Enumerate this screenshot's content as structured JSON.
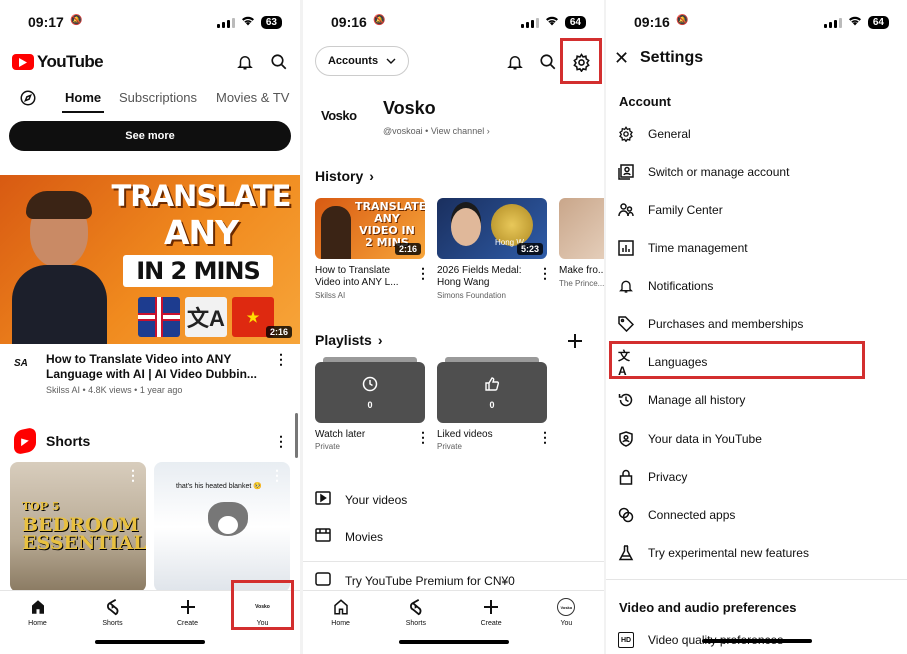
{
  "status": {
    "p1_time": "09:17",
    "p2_time": "09:16",
    "p3_time": "09:16",
    "p1_battery": "63",
    "p2_battery": "64",
    "p3_battery": "64"
  },
  "colors": {
    "youtube_red": "#ff0000",
    "highlight_box": "#d32f2f"
  },
  "home": {
    "logo_text": "YouTube",
    "tabs": [
      "Home",
      "Subscriptions",
      "Movies & TV"
    ],
    "see_more": "See more",
    "featured": {
      "thumb_line1": "TRANSLATE",
      "thumb_line2": "ANY VIDEO",
      "thumb_line3": "IN 2 MINS",
      "duration": "2:16",
      "channel_logo": "SA",
      "title": "How to Translate Video into ANY Language with AI | AI Video Dubbin...",
      "meta": "Skilss AI • 4.8K views • 1 year ago"
    },
    "shorts_label": "Shorts",
    "short1_line1": "TOP 5",
    "short1_line2": "BEDROOM",
    "short1_line3": "ESSENTIALS",
    "short2_caption": "that's his heated blanket 🥺"
  },
  "nav": {
    "home": "Home",
    "shorts": "Shorts",
    "create": "Create",
    "you": "You",
    "you_avatar": "Vosko"
  },
  "you_page": {
    "accounts_label": "Accounts",
    "channel_logo": "Vosko",
    "channel_name": "Vosko",
    "handle": "@voskoai",
    "view_channel": "View channel",
    "history_label": "History",
    "history": [
      {
        "title": "How to Translate Video into ANY L...",
        "channel": "Skilss AI",
        "duration": "2:16",
        "thumb_text": "TRANSLATE ANY VIDEO IN 2 MINS"
      },
      {
        "title": "2026 Fields Medal: Hong Wang",
        "channel": "Simons Foundation",
        "duration": "5:23",
        "thumb_text": "Hong W..."
      },
      {
        "title": "Make fro... ice crean...",
        "channel": "The Prince..."
      }
    ],
    "playlists_label": "Playlists",
    "playlists": [
      {
        "title": "Watch later",
        "sub": "Private",
        "count": "0"
      },
      {
        "title": "Liked videos",
        "sub": "Private",
        "count": "0"
      }
    ],
    "your_videos": "Your videos",
    "movies": "Movies",
    "premium": "Try YouTube Premium for CN¥0"
  },
  "settings": {
    "title": "Settings",
    "account_section": "Account",
    "items": [
      {
        "label": "General",
        "icon": "gear-icon"
      },
      {
        "label": "Switch or manage account",
        "icon": "switch-account-icon"
      },
      {
        "label": "Family Center",
        "icon": "family-icon"
      },
      {
        "label": "Time management",
        "icon": "chart-icon"
      },
      {
        "label": "Notifications",
        "icon": "bell-icon"
      },
      {
        "label": "Purchases and memberships",
        "icon": "tag-icon"
      },
      {
        "label": "Languages",
        "icon": "translate-icon"
      },
      {
        "label": "Manage all history",
        "icon": "history-icon"
      },
      {
        "label": "Your data in YouTube",
        "icon": "shield-person-icon"
      },
      {
        "label": "Privacy",
        "icon": "lock-icon"
      },
      {
        "label": "Connected apps",
        "icon": "link-icon"
      },
      {
        "label": "Try experimental new features",
        "icon": "flask-icon"
      }
    ],
    "video_section": "Video and audio preferences",
    "video_quality": "Video quality preferences",
    "hd_icon_text": "HD"
  }
}
